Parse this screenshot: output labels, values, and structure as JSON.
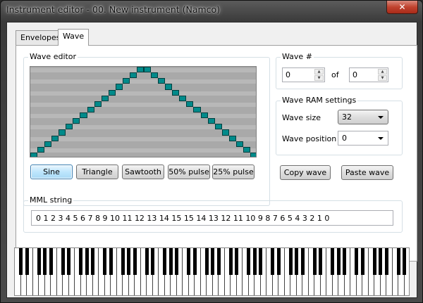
{
  "window": {
    "title": "Instrument editor - 00. New instrument (Namco)",
    "close_label": "✕"
  },
  "tabs": [
    {
      "label": "Envelopes"
    },
    {
      "label": "Wave"
    }
  ],
  "wave_editor": {
    "label": "Wave editor",
    "samples": [
      0,
      1,
      2,
      3,
      4,
      5,
      6,
      7,
      8,
      9,
      10,
      11,
      12,
      13,
      14,
      15,
      15,
      14,
      13,
      12,
      11,
      10,
      9,
      8,
      7,
      6,
      5,
      4,
      3,
      2,
      1,
      0
    ],
    "preset_buttons": [
      "Sine",
      "Triangle",
      "Sawtooth",
      "50% pulse",
      "25% pulse"
    ],
    "colors": {
      "background": "#a9a9a9",
      "stripe": "#b8b8b8",
      "cell": "#008a8a"
    }
  },
  "wave_number": {
    "label": "Wave #",
    "value": "0",
    "of_label": "of",
    "total": "0"
  },
  "wave_ram": {
    "label": "Wave RAM settings",
    "size_label": "Wave size",
    "size_value": "32",
    "position_label": "Wave position",
    "position_value": "0"
  },
  "copy_label": "Copy wave",
  "paste_label": "Paste wave",
  "mml": {
    "label": "MML string",
    "value": "0 1 2 3 4 5 6 7 8 9 10 11 12 13 14 15 15 14 13 12 11 10 9 8 7 6 5 4 3 2 1 0"
  },
  "piano": {
    "white_keys": 66
  }
}
